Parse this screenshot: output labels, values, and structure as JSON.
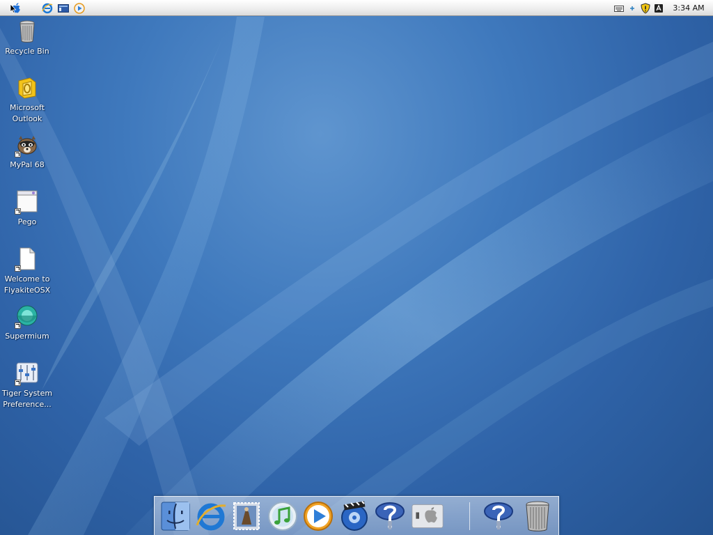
{
  "menubar": {
    "apple_icon": "apple-logo-icon",
    "quick_launch": [
      "internet-explorer-icon",
      "show-desktop-icon",
      "media-player-icon"
    ],
    "tray_icons": [
      "keyboard-icon",
      "plus-icon",
      "security-shield-icon",
      "language-icon"
    ],
    "clock": "3:34 AM"
  },
  "desktop": {
    "icons": [
      {
        "label": "Recycle Bin",
        "icon": "recycle-bin-icon"
      },
      {
        "label": "Microsoft\nOutlook",
        "icon": "outlook-icon"
      },
      {
        "label": "MyPal 68",
        "icon": "mypal-icon"
      },
      {
        "label": "Pego",
        "icon": "pego-icon"
      },
      {
        "label": "Welcome to\nFlyakiteOSX",
        "icon": "document-icon"
      },
      {
        "label": "Supermium",
        "icon": "supermium-icon"
      },
      {
        "label": "Tiger System\nPreference...",
        "icon": "system-preferences-icon"
      }
    ]
  },
  "dock": {
    "items": [
      "finder-icon",
      "internet-explorer-icon",
      "mail-stamp-icon",
      "itunes-icon",
      "media-player-icon",
      "dvd-player-icon",
      "help-icon",
      "system-switch-icon",
      "help-icon",
      "trash-icon"
    ]
  },
  "colors": {
    "desktop_background": "#3f79bd",
    "menubar": "#eeeeee",
    "label_text": "#ffffff"
  }
}
